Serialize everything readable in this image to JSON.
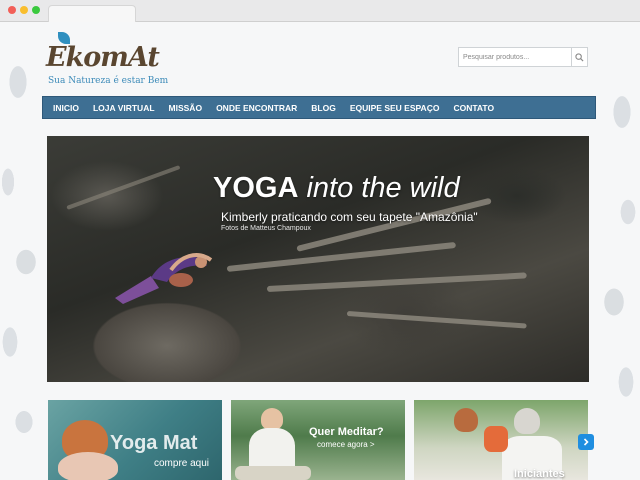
{
  "header": {
    "logo_text": "EkomAt",
    "tagline": "Sua Natureza é estar Bem"
  },
  "search": {
    "placeholder": "Pesquisar produtos..."
  },
  "nav": {
    "items": [
      {
        "label": "INICIO"
      },
      {
        "label": "LOJA VIRTUAL"
      },
      {
        "label": "MISSÃO"
      },
      {
        "label": "ONDE ENCONTRAR"
      },
      {
        "label": "BLOG"
      },
      {
        "label": "EQUIPE SEU ESPAÇO"
      },
      {
        "label": "CONTATO"
      }
    ]
  },
  "hero": {
    "title_bold": "YOGA",
    "title_italic": "into the wild",
    "subtitle": "Kimberly praticando com seu tapete \"Amazônia\"",
    "credit": "Fotos de Matteus Champoux"
  },
  "promos": {
    "yoga_mat": {
      "title": "Yoga Mat",
      "subtitle": "compre aqui"
    },
    "meditar": {
      "title": "Quer Meditar?",
      "subtitle": "comece agora >"
    },
    "iniciantes": {
      "title": "Iniciantes"
    }
  },
  "icons": {
    "search": "search-icon",
    "next": "chevron-right-icon"
  },
  "colors": {
    "nav_bg": "#3e6f93",
    "logo_blue": "#3b8ab8",
    "logo_brown": "#5a4630",
    "arrow_blue": "#1f8ee0"
  }
}
